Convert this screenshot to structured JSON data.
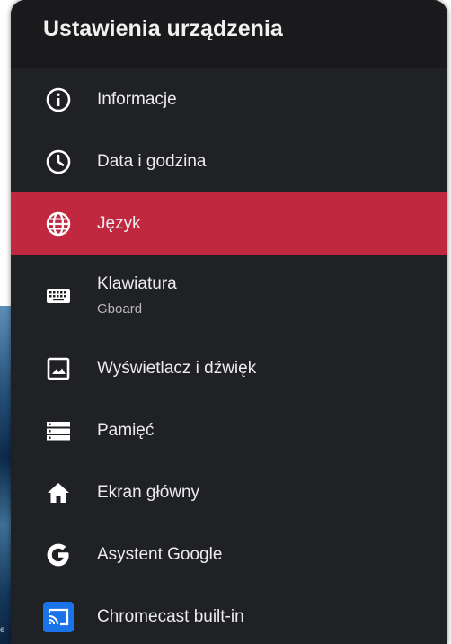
{
  "header": {
    "title": "Ustawienia urządzenia"
  },
  "menu": {
    "items": [
      {
        "label": "Informacje",
        "icon": "info-icon"
      },
      {
        "label": "Data i godzina",
        "icon": "clock-icon"
      },
      {
        "label": "Język",
        "icon": "globe-icon",
        "selected": true
      },
      {
        "label": "Klawiatura",
        "sublabel": "Gboard",
        "icon": "keyboard-icon"
      },
      {
        "label": "Wyświetlacz i dźwięk",
        "icon": "image-icon"
      },
      {
        "label": "Pamięć",
        "icon": "storage-icon"
      },
      {
        "label": "Ekran główny",
        "icon": "home-icon"
      },
      {
        "label": "Asystent Google",
        "icon": "google-icon"
      },
      {
        "label": "Chromecast built-in",
        "icon": "cast-icon"
      }
    ]
  },
  "background": {
    "snippet": "e"
  },
  "colors": {
    "panel": "#202124",
    "header": "#1a1a1c",
    "selected": "#c0283f",
    "cast_badge": "#1a73e8",
    "text": "#ececec"
  }
}
